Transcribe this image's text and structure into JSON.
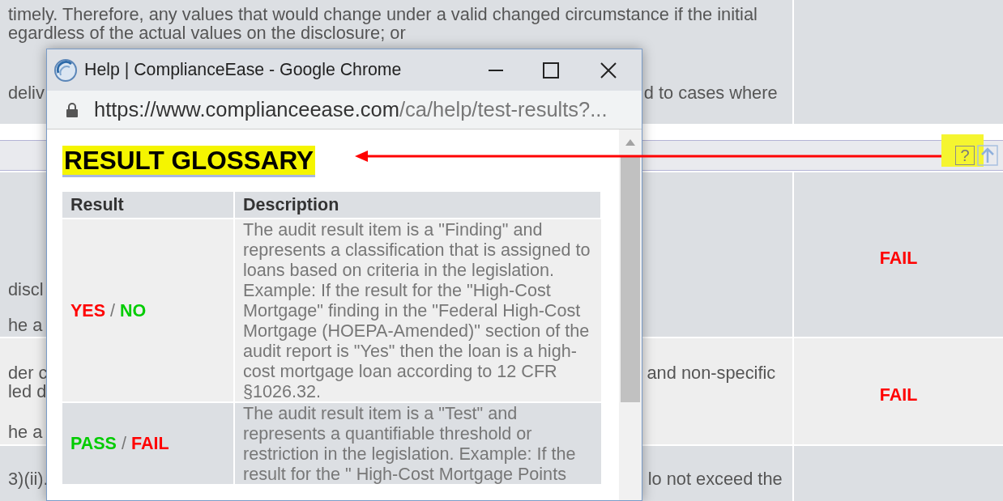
{
  "background": {
    "rows": [
      {
        "lines": [
          {
            "left": "timely. Therefore, any values that would change under a valid changed circumstance if the initial"
          },
          {
            "left": "egardless of the actual values on the disclosure; or"
          },
          {
            "left": "deliv",
            "right": "d to cases where"
          }
        ]
      },
      {
        "lines": [
          {
            "left": "discl"
          },
          {
            "left": "he a"
          }
        ],
        "result": "FAIL"
      },
      {
        "lines": [
          {
            "left": "der c",
            "right": "and non-specific"
          },
          {
            "left": "led d"
          },
          {
            "left": "he a"
          }
        ],
        "result": "FAIL"
      },
      {
        "lines": [
          {
            "left": "3)(ii).",
            "right": "lo not exceed the"
          }
        ]
      }
    ],
    "toolbar": {
      "help_label": "?"
    }
  },
  "popup": {
    "window": {
      "title": "Help | ComplianceEase - Google Chrome"
    },
    "address": {
      "domain": "https://www.complianceease.com",
      "path": "/ca/help/test-results?..."
    },
    "heading": "RESULT GLOSSARY",
    "table": {
      "columns": [
        "Result",
        "Description"
      ],
      "rows": [
        {
          "separator": "/",
          "result": [
            {
              "text": "YES",
              "color": "#ff0000"
            },
            {
              "text": "NO",
              "color": "#00cc00"
            }
          ],
          "description": "The audit result item is a \"Finding\" and represents a classification that is assigned to loans based on criteria in the legislation. Example: If the result for the \"High-Cost Mortgage\" finding in the \"Federal High-Cost Mortgage (HOEPA-Amended)\" section of the audit report is \"Yes\" then the loan is a high-cost mortgage loan according to 12 CFR §1026.32."
        },
        {
          "separator": "/",
          "result": [
            {
              "text": "PASS",
              "color": "#00cc00"
            },
            {
              "text": "FAIL",
              "color": "#ff0000"
            }
          ],
          "description": "The audit result item is a \"Test\" and represents a quantifiable threshold or restriction in the legislation. Example: If the result for the \" High-Cost Mortgage Points"
        }
      ]
    }
  }
}
